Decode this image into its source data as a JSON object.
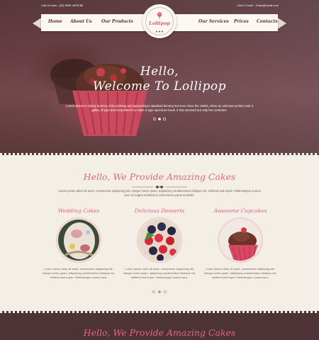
{
  "topbar": {
    "contact": "Call Us Now : (02) 5936 4578785",
    "login": "Get In Touch : Team@Email.com"
  },
  "nav": {
    "left_items": [
      "Home",
      "About Us",
      "Our Products"
    ],
    "right_items": [
      "Our Services",
      "Prices",
      "Contacts"
    ],
    "logo_text": "Lollipop"
  },
  "hero": {
    "title_line1": "Hello,",
    "title_line2": "Welcome To Lollipop",
    "description": "Lorem Ipsum is simply dummy of the printing and typesetting's standard dummy text ever since the 1500s, when an unknown printer took a galley of type and scrambled it to make a type specimen book. It has survived not only five centuries."
  },
  "intro": {
    "title": "Hello, We Provide Amazing Cakes",
    "text": "Lorem ipsum dolor sit amet, consectetur adipiscing elit. Integer lorem quam, adipiscing condimentum tristique vel, eleifend sed turpis. Pellentesque cursus arcu id magna euismod in elementum purus molestie."
  },
  "features": [
    {
      "title": "Wedding Cakes",
      "text": "Lorem ipsum dolor sit amet, consectetur adipiscing elit. Integer lorem quam, adipiscing condimentum tristique vel, eleifend sed turpis. Pellentesque cursus arcu."
    },
    {
      "title": "Delicious Desserts",
      "text": "Lorem ipsum dolor sit amet, consectetur adipiscing elit. Integer lorem quam, adipiscing condimentum tristique vel, eleifend sed turpis. Pellentesque cursus arcu."
    },
    {
      "title": "Awesome Cupcakes",
      "text": "Lorem ipsum dolor sit amet, consectetur adipiscing elit. Integer lorem quam, adipiscing condimentum tristique vel, eleifend sed turpis. Pellentesque cursus arcu."
    }
  ],
  "bottom": {
    "title": "Hello, We Provide Amazing Cakes"
  },
  "colors": {
    "accent": "#e56680",
    "dark": "#4e3336",
    "background": "#f3efe7"
  }
}
